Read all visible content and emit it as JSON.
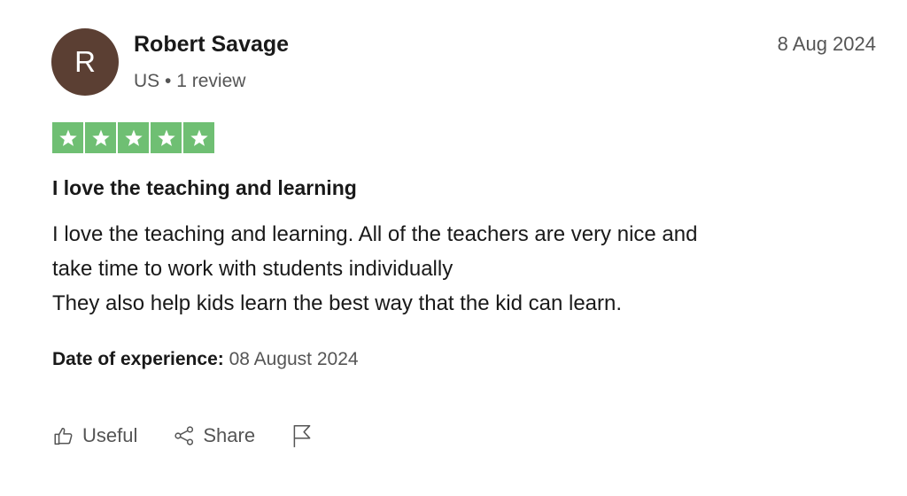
{
  "consumer": {
    "avatar_initial": "R",
    "name": "Robert Savage",
    "country": "US",
    "separator": "•",
    "review_count": "1 review"
  },
  "review": {
    "date": "8 Aug 2024",
    "rating": 5,
    "rating_max": 5,
    "star_color": "#6fbf73",
    "title": "I love the teaching and learning",
    "body_lines": [
      "I love the teaching and learning. All of the teachers are very nice and",
      "take time to work with students individually",
      "They also help kids learn the best way that the kid can learn."
    ],
    "experience_label": "Date of experience:",
    "experience_date": "08 August 2024"
  },
  "actions": {
    "useful_label": "Useful",
    "useful_icon": "thumbs-up-icon",
    "share_label": "Share",
    "share_icon": "share-icon",
    "report_icon": "flag-icon"
  },
  "colors": {
    "avatar_bg": "#5b3f33",
    "text_primary": "#191919",
    "text_secondary": "#555555"
  }
}
